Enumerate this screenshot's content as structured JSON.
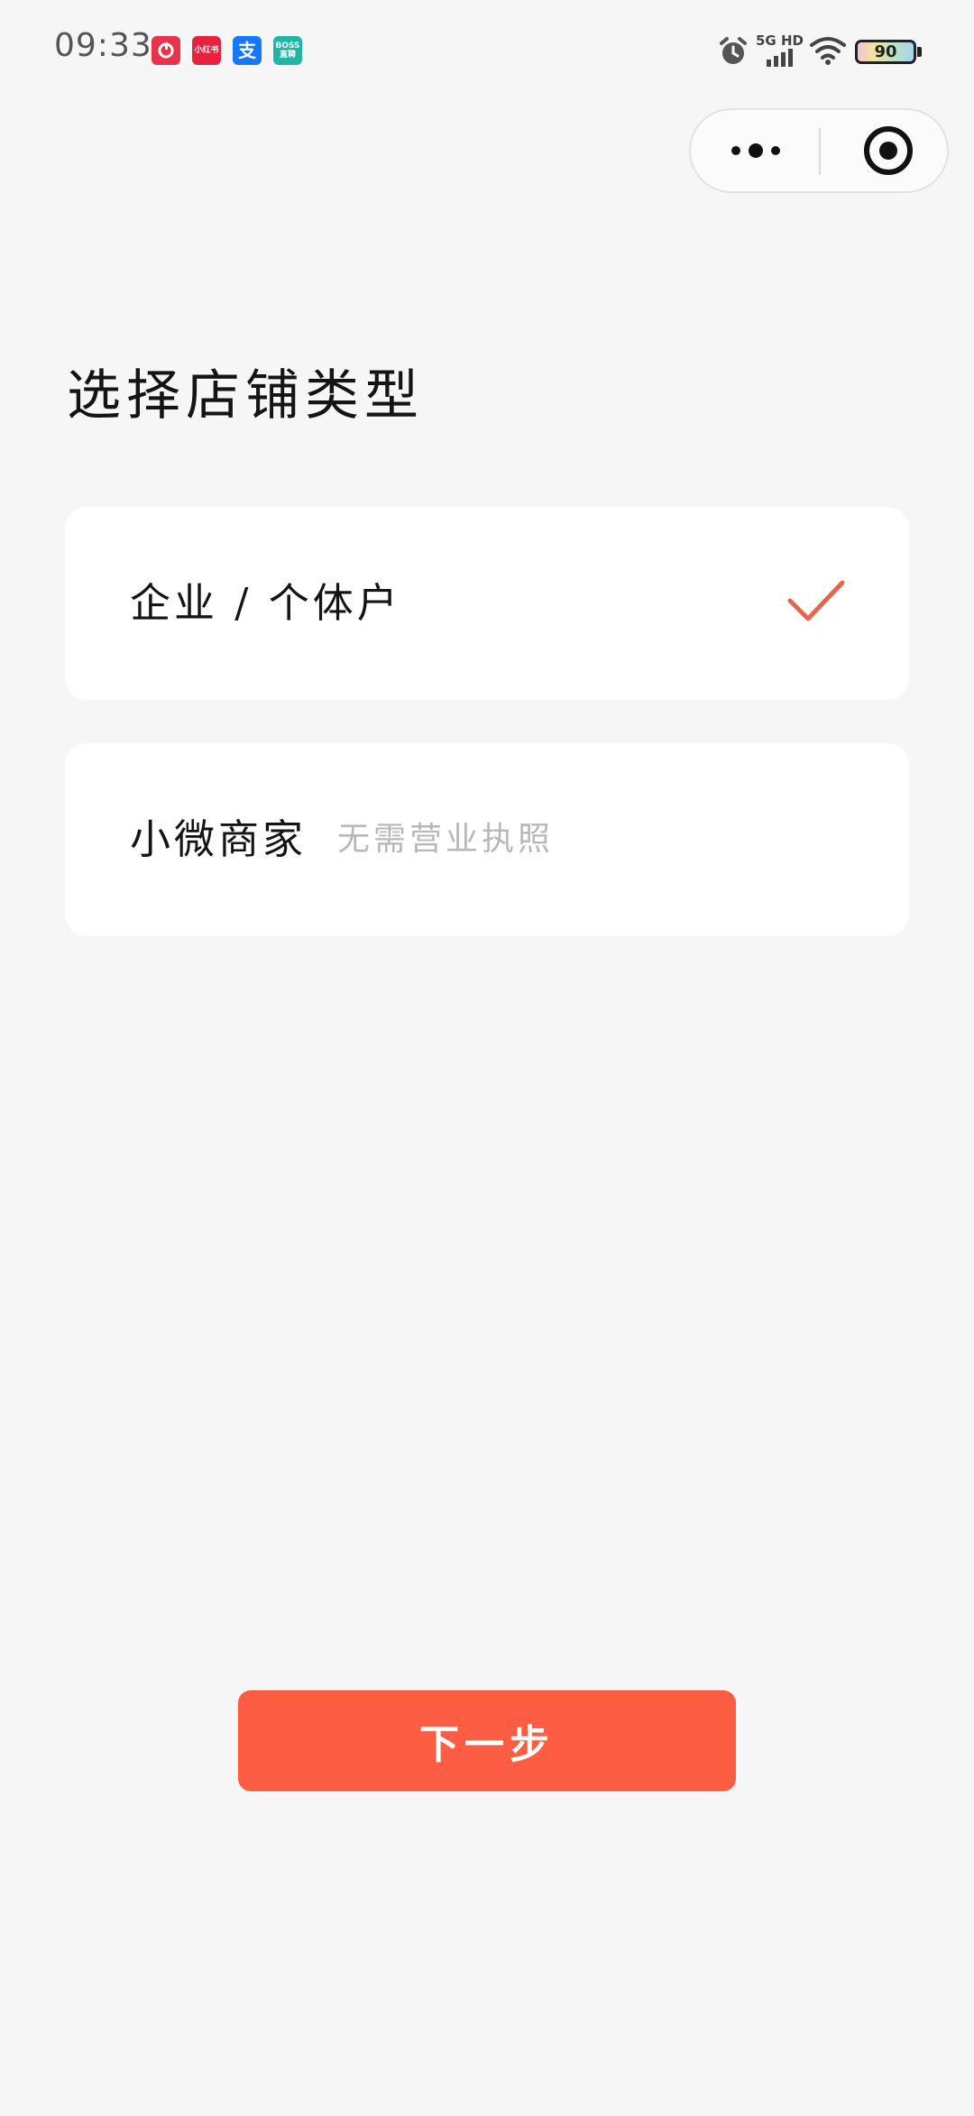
{
  "status_bar": {
    "time": "09:33",
    "apps": [
      {
        "icon": "app-red-ring-icon",
        "text": "",
        "color": "#e8344a"
      },
      {
        "icon": "xiaohongshu-icon",
        "text": "小红书",
        "color": "#e6223e"
      },
      {
        "icon": "alipay-icon",
        "text": "支",
        "color": "#1677ff"
      },
      {
        "icon": "boss-zhipin-icon",
        "text": "BOSS直聘",
        "color": "#1fb6a5"
      }
    ],
    "network": "5G HD",
    "battery": "90"
  },
  "capsule": {
    "more_icon": "more-dots-icon",
    "close_icon": "target-close-icon"
  },
  "page": {
    "title": "选择店铺类型",
    "options": [
      {
        "label": "企业 / 个体户",
        "subtitle": "",
        "selected": true
      },
      {
        "label": "小微商家",
        "subtitle": "无需营业执照",
        "selected": false
      }
    ],
    "next_button": "下一步"
  },
  "colors": {
    "background": "#f6f6f6",
    "card": "#ffffff",
    "accent": "#fd5e43",
    "check": "#e8644a",
    "muted_text": "#b8b8b8"
  }
}
